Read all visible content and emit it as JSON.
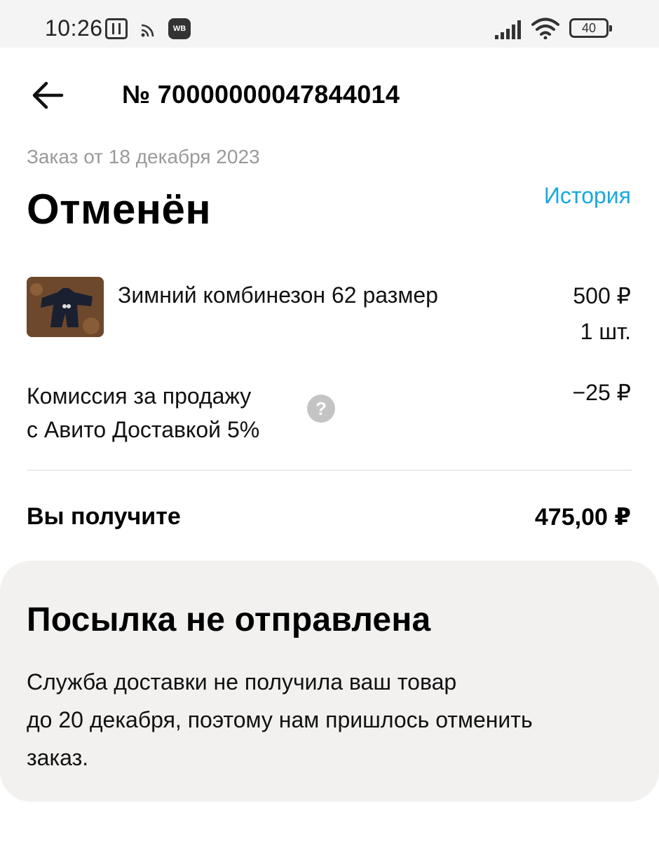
{
  "status_bar": {
    "time": "10:26",
    "wb_badge": "WB",
    "battery": "40",
    "icons": [
      "nfc-icon",
      "cast-icon",
      "wb-app-icon",
      "signal-icon",
      "wifi-icon",
      "battery-icon"
    ]
  },
  "header": {
    "back_icon": "arrow-left-icon",
    "order_number": "№ 70000000047844014"
  },
  "order": {
    "date": "Заказ от 18 декабря 2023",
    "status": "Отменён",
    "history_link": "История"
  },
  "product": {
    "name": "Зимний комбинезон 62 размер",
    "price": "500 ₽",
    "quantity": "1 шт."
  },
  "commission": {
    "line1": "Комиссия за продажу",
    "line2": "с Авито Доставкой 5%",
    "help_icon_text": "?",
    "value": "−25 ₽"
  },
  "total": {
    "label": "Вы получите",
    "value": "475,00 ₽"
  },
  "parcel": {
    "title": "Посылка не отправлена",
    "text_lines": [
      "Служба доставки не получила ваш товар",
      "до 20 декабря, поэтому нам пришлось отменить",
      "заказ."
    ]
  },
  "colors": {
    "accent_link": "#18a8e0",
    "muted_text": "#9a9a9a",
    "card_background": "#f2f1f0",
    "status_bar_background": "#f4f4f4"
  }
}
